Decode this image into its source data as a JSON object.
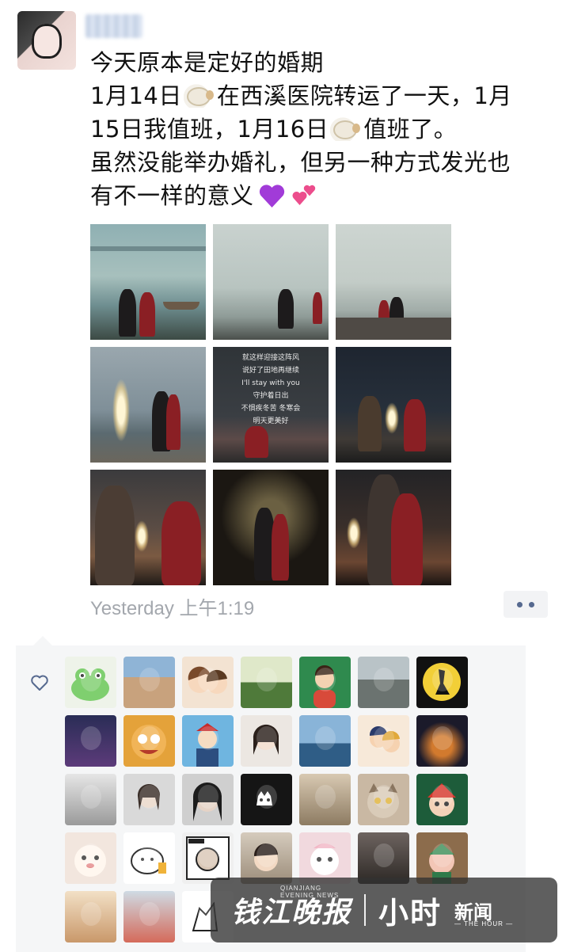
{
  "post": {
    "text_lines": {
      "line1": "今天原本是定好的婚期",
      "line2_a": "1月14日",
      "line2_b": "在西溪医院转运了一天，1月",
      "line3_a": "15日我值班，1月16日",
      "line3_b": "值班了。",
      "line4": "虽然没能举办婚礼，但另一种方式发光也",
      "line5": "有不一样的意义"
    },
    "emoji": {
      "sheep": "sheep-emoji",
      "purple_heart": "purple-heart-emoji",
      "two_hearts": "two-hearts-emoji"
    },
    "photo_caption": {
      "line1": "就这样迎接这阵风",
      "line2": "说好了田地再继续",
      "line3": "I'll stay with you",
      "line4": "守护着日出",
      "line5": "不惧疾冬苦 冬寒会",
      "line6": "明天更美好"
    },
    "timestamp": "Yesterday 上午1:19",
    "likes_count_rows": 5
  },
  "likes": {
    "icon": "heart-outline-icon"
  },
  "watermark": {
    "brand": "钱江晚报",
    "brand_sub": "QIANJIANG EVENING NEWS",
    "hour": "小时",
    "news": "新闻",
    "news_sub": "— THE HOUR —"
  },
  "colors": {
    "link_blue": "#56698f",
    "timestamp_gray": "#a3a7ad",
    "panel_bg": "#f5f6f7"
  }
}
